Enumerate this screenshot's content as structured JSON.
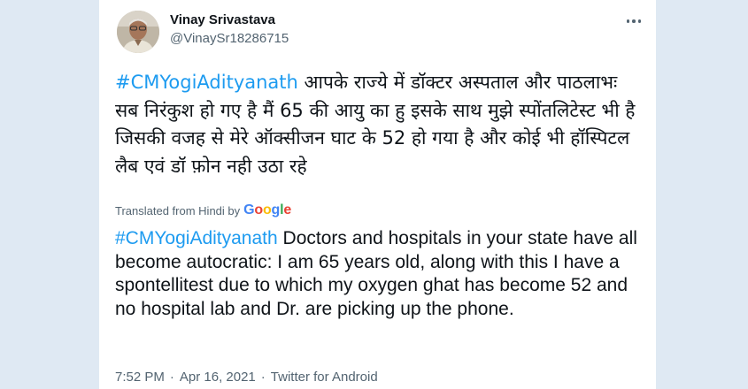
{
  "tweet": {
    "author_name": "Vinay Srivastava",
    "author_handle": "@VinaySr18286715",
    "hashtag": "#CMYogiAdityanath",
    "original_text": "आपके राज्ये में डॉक्टर अस्पताल और पाठलाभः सब निरंकुश हो गए है मैं 65 की आयु का हु इसके साथ मुझे स्पोंतलिटेस्ट  भी है जिसकी वजह से मेरे ऑक्सीजन घाट के 52 हो गया है और कोई भी हॉस्पिटल लैब एवं डॉ फ़ोन नही उठा रहे",
    "translated_from": "Translated from Hindi by",
    "translation_provider": "Google",
    "translated_text": "Doctors and hospitals in your state have all become autocratic: I am 65 years old, along with this I have a spontellitest due to which my oxygen ghat has become 52 and no hospital lab and Dr. are picking up the phone.",
    "time": "7:52 PM",
    "date": "Apr 16, 2021",
    "source": "Twitter for Android",
    "separator": "·"
  },
  "icons": {
    "more": "more-horizontal-icon",
    "avatar": "profile-photo"
  },
  "colors": {
    "link": "#1d9bf0",
    "text": "#0f1419",
    "secondary": "#536471",
    "background": "#dfe9f3"
  }
}
